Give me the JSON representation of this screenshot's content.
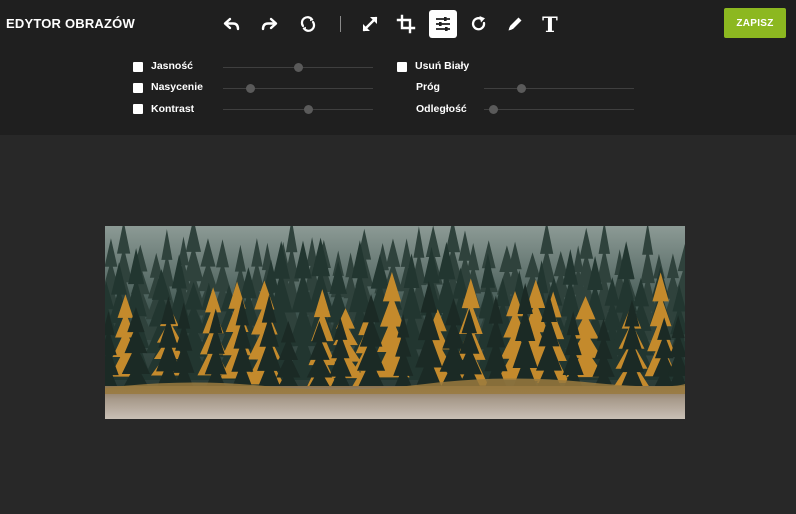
{
  "app": {
    "title": "EDYTOR OBRAZÓW"
  },
  "toolbar": {
    "tools": [
      {
        "name": "undo",
        "icon": "undo-icon"
      },
      {
        "name": "redo",
        "icon": "redo-icon"
      },
      {
        "name": "reset",
        "icon": "reset-icon"
      },
      {
        "name": "resize",
        "icon": "resize-icon"
      },
      {
        "name": "crop",
        "icon": "crop-icon"
      },
      {
        "name": "adjust",
        "icon": "sliders-icon",
        "active": true
      },
      {
        "name": "rotate",
        "icon": "rotate-icon"
      },
      {
        "name": "draw",
        "icon": "pencil-icon"
      },
      {
        "name": "text",
        "icon": "text-icon",
        "glyph": "T"
      }
    ],
    "save_label": "ZAPISZ"
  },
  "adjustments": {
    "left": [
      {
        "label": "Jasność",
        "checked": false,
        "value": 0.5
      },
      {
        "label": "Nasycenie",
        "checked": false,
        "value": 0.18
      },
      {
        "label": "Kontrast",
        "checked": false,
        "value": 0.57
      }
    ],
    "right": {
      "remove_white": {
        "label": "Usuń Biały",
        "checked": false
      },
      "threshold": {
        "label": "Próg",
        "value": 0.25
      },
      "distance": {
        "label": "Odległość",
        "value": 0.06
      }
    }
  },
  "colors": {
    "topbar": "#1f1f1f",
    "canvas": "#282828",
    "accent": "#8cb820",
    "track": "#3f3f3f",
    "thumb": "#5a5a5a"
  }
}
